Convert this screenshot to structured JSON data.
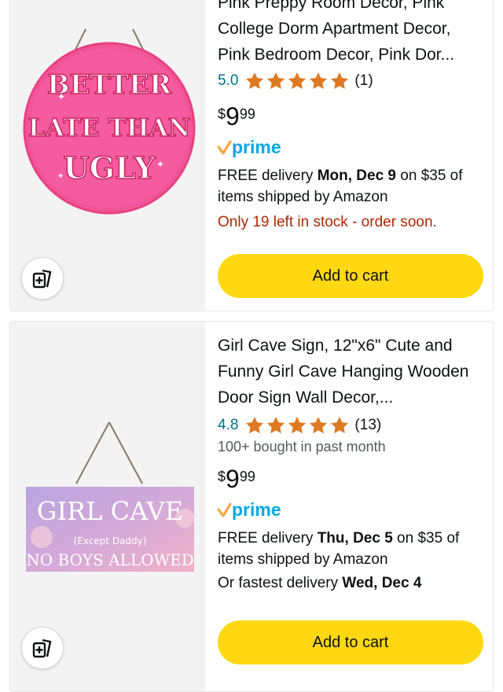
{
  "products": [
    {
      "title": "Pink Preppy Room Decor, Pink College Dorm Apartment Decor, Pink Bedroom Decor, Pink Dor...",
      "rating": "5.0",
      "review_count": "(1)",
      "stars_filled": 5,
      "price_symbol": "$",
      "price_whole": "9",
      "price_fraction": "99",
      "prime_label": "prime",
      "delivery_prefix": "FREE delivery ",
      "delivery_date": "Mon, Dec 9",
      "delivery_suffix": " on $35 of items shipped by Amazon",
      "stock_note": "Only 19 left in stock - order soon.",
      "cart_label": "Add to cart",
      "sign_text": [
        "BETTER",
        "LATE THAN",
        "UGLY"
      ]
    },
    {
      "title": "Girl Cave Sign, 12\"x6\" Cute and Funny Girl Cave Hanging Wooden Door Sign Wall Decor,...",
      "rating": "4.8",
      "review_count": "(13)",
      "stars_filled": 5,
      "bought_note": "100+ bought in past month",
      "price_symbol": "$",
      "price_whole": "9",
      "price_fraction": "99",
      "prime_label": "prime",
      "delivery_prefix": "FREE delivery ",
      "delivery_date": "Thu, Dec 5",
      "delivery_suffix": " on $35 of items shipped by Amazon",
      "fast_prefix": "Or fastest delivery ",
      "fast_date": "Wed, Dec 4",
      "cart_label": "Add to cart",
      "sign_text": [
        "GIRL CAVE",
        "(Except Daddy)",
        "NO BOYS ALLOWED"
      ]
    }
  ],
  "colors": {
    "cart_button": "#FFD814",
    "star": "#DE7921",
    "rating_link": "#007185",
    "stock_warning": "#B12704",
    "prime_blue": "#00A8E1",
    "prime_check": "#F3A847"
  }
}
